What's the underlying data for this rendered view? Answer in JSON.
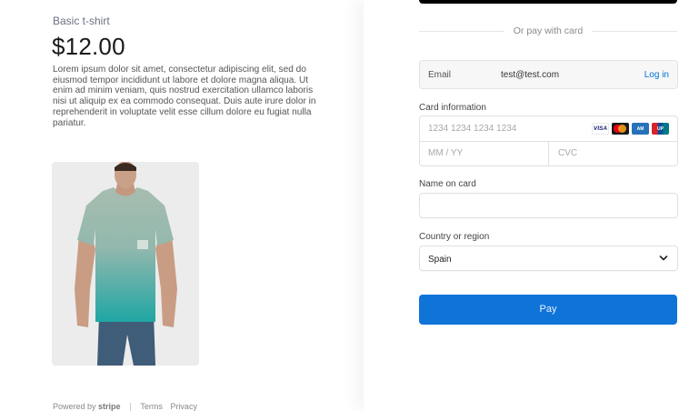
{
  "product": {
    "name": "Basic t-shirt",
    "price": "$12.00",
    "description": "Lorem ipsum dolor sit amet, consectetur adipiscing elit, sed do eiusmod tempor incididunt ut labore et dolore magna aliqua. Ut enim ad minim veniam, quis nostrud exercitation ullamco laboris nisi ut aliquip ex ea commodo consequat. Duis aute irure dolor in reprehenderit in voluptate velit esse cillum dolore eu fugiat nulla pariatur."
  },
  "footer": {
    "powered_by": "Powered by",
    "brand": "stripe",
    "terms": "Terms",
    "privacy": "Privacy"
  },
  "checkout": {
    "divider_text": "Or pay with card",
    "email_label": "Email",
    "email_value": "test@test.com",
    "login_label": "Log in",
    "card_label": "Card information",
    "card_number_placeholder": "1234 1234 1234 1234",
    "expiry_placeholder": "MM / YY",
    "cvc_placeholder": "CVC",
    "card_brands": [
      "VISA",
      "mastercard",
      "AMEX",
      "UnionPay"
    ],
    "name_label": "Name on card",
    "name_value": "",
    "country_label": "Country or region",
    "country_value": "Spain",
    "pay_label": "Pay"
  },
  "colors": {
    "pay_button": "#0f74d8",
    "link": "#0074d4"
  }
}
